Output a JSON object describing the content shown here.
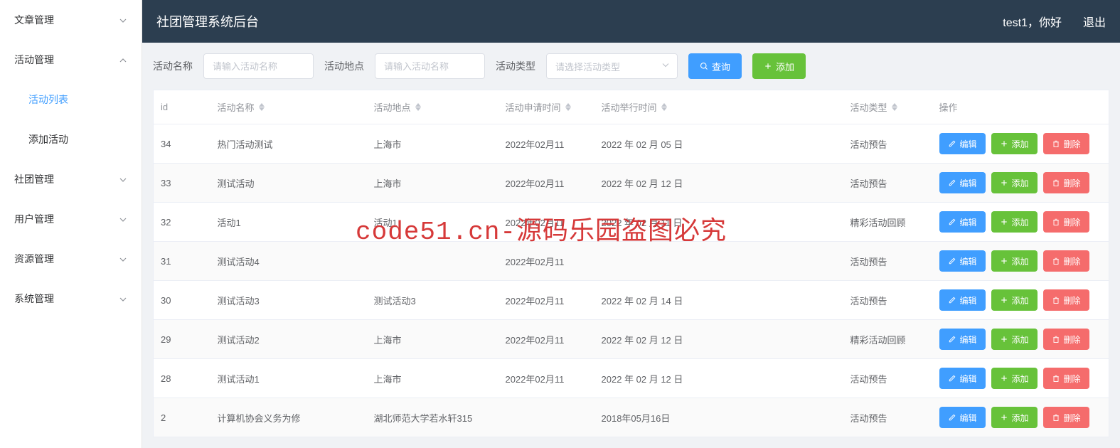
{
  "header": {
    "title": "社团管理系统后台",
    "greeting": "test1，你好",
    "logout": "退出"
  },
  "sidebar": {
    "items": [
      {
        "label": "文章管理",
        "expanded": false,
        "children": []
      },
      {
        "label": "活动管理",
        "expanded": true,
        "children": [
          {
            "label": "活动列表",
            "active": true
          },
          {
            "label": "添加活动",
            "active": false
          }
        ]
      },
      {
        "label": "社团管理",
        "expanded": false,
        "children": []
      },
      {
        "label": "用户管理",
        "expanded": false,
        "children": []
      },
      {
        "label": "资源管理",
        "expanded": false,
        "children": []
      },
      {
        "label": "系统管理",
        "expanded": false,
        "children": []
      }
    ]
  },
  "filters": {
    "name_label": "活动名称",
    "name_placeholder": "请输入活动名称",
    "location_label": "活动地点",
    "location_placeholder": "请输入活动名称",
    "type_label": "活动类型",
    "type_placeholder": "请选择活动类型",
    "search_btn": "查询",
    "add_btn": "添加"
  },
  "table": {
    "headers": {
      "id": "id",
      "name": "活动名称",
      "location": "活动地点",
      "apply_time": "活动申请时间",
      "hold_time": "活动举行时间",
      "type": "活动类型",
      "action": "操作"
    },
    "action_labels": {
      "edit": "编辑",
      "add": "添加",
      "delete": "删除"
    },
    "rows": [
      {
        "id": "34",
        "name": "热门活动测试",
        "location": "上海市",
        "apply_time": "2022年02月11",
        "hold_time": "2022 年 02 月 05 日",
        "type": "活动预告"
      },
      {
        "id": "33",
        "name": "测试活动",
        "location": "上海市",
        "apply_time": "2022年02月11",
        "hold_time": "2022 年 02 月 12 日",
        "type": "活动预告"
      },
      {
        "id": "32",
        "name": "活动1",
        "location": "活动1",
        "apply_time": "2022年02月11",
        "hold_time": "2022 年 02 月 11 日",
        "type": "精彩活动回顾"
      },
      {
        "id": "31",
        "name": "测试活动4",
        "location": "",
        "apply_time": "2022年02月11",
        "hold_time": "",
        "type": "活动预告"
      },
      {
        "id": "30",
        "name": "测试活动3",
        "location": "测试活动3",
        "apply_time": "2022年02月11",
        "hold_time": "2022 年 02 月 14 日",
        "type": "活动预告"
      },
      {
        "id": "29",
        "name": "测试活动2",
        "location": "上海市",
        "apply_time": "2022年02月11",
        "hold_time": "2022 年 02 月 12 日",
        "type": "精彩活动回顾"
      },
      {
        "id": "28",
        "name": "测试活动1",
        "location": "上海市",
        "apply_time": "2022年02月11",
        "hold_time": "2022 年 02 月 12 日",
        "type": "活动预告"
      },
      {
        "id": "2",
        "name": "计算机协会义务为修",
        "location": "湖北师范大学若水轩315",
        "apply_time": "",
        "hold_time": "2018年05月16日",
        "type": "活动预告"
      }
    ]
  },
  "watermark": "code51.cn-源码乐园盗图必究"
}
